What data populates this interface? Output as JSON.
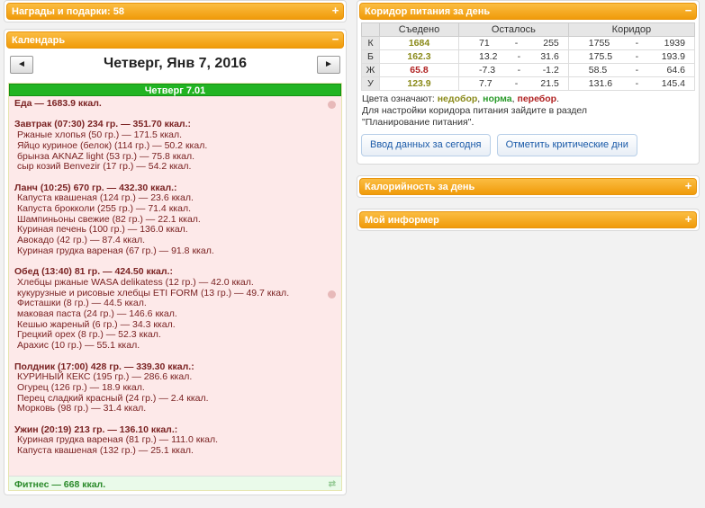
{
  "awards": {
    "title": "Награды и подарки: 58",
    "toggle": "+"
  },
  "calendar": {
    "title": "Календарь",
    "toggle": "−",
    "prev_label": "◄",
    "next_label": "►",
    "date": "Четверг, Янв 7, 2016",
    "day_header": "Четверг 7.01",
    "food_total": "Еда — 1683.9 ккал.",
    "meals": [
      {
        "title": "Завтрак (07:30) 234 гр. — 351.70 ккал.:",
        "items": [
          "Ржаные хлопья (50 гр.) — 171.5 ккал.",
          "Яйцо куриное (белок) (114 гр.) — 50.2 ккал.",
          "брынза AKNAZ light (53 гр.) — 75.8 ккал.",
          "сыр козий Benvezir (17 гр.) — 54.2 ккал."
        ]
      },
      {
        "title": "Ланч (10:25) 670 гр. — 432.30 ккал.:",
        "items": [
          "Капуста квашеная (124 гр.) — 23.6 ккал.",
          "Капуста брокколи (255 гр.) — 71.4 ккал.",
          "Шампиньоны свежие (82 гр.) — 22.1 ккал.",
          "Куриная печень (100 гр.) — 136.0 ккал.",
          "Авокадо (42 гр.) — 87.4 ккал.",
          "Куриная грудка вареная (67 гр.) — 91.8 ккал."
        ]
      },
      {
        "title": "Обед (13:40) 81 гр. — 424.50 ккал.:",
        "items": [
          "Хлебцы ржаные WASA delikatess (12 гр.) — 42.0 ккал.",
          "кукурузные и рисовые хлебцы ETI FORM (13 гр.) — 49.7 ккал.",
          "Фисташки (8 гр.) — 44.5 ккал.",
          "маковая паста (24 гр.) — 146.6 ккал.",
          "Кешью жареный (6 гр.) — 34.3 ккал.",
          "Грецкий орех (8 гр.) — 52.3 ккал.",
          "Арахис (10 гр.) — 55.1 ккал."
        ]
      },
      {
        "title": "Полдник (17:00) 428 гр. — 339.30 ккал.:",
        "items": [
          "КУРИНЫЙ КЕКС (195 гр.) — 286.6 ккал.",
          "Огурец (126 гр.) — 18.9 ккал.",
          "Перец сладкий красный (24 гр.) — 2.4 ккал.",
          "Морковь (98 гр.) — 31.4 ккал."
        ]
      },
      {
        "title": "Ужин (20:19) 213 гр. — 136.10 ккал.:",
        "items": [
          "Куриная грудка вареная (81 гр.) — 111.0 ккал.",
          "Капуста квашеная (132 гр.) — 25.1 ккал."
        ]
      }
    ],
    "fitness": "Фитнес — 668 ккал."
  },
  "corridor": {
    "title": "Коридор питания за день",
    "toggle": "−",
    "headers": [
      "",
      "Съедено",
      "Осталось",
      "Коридор"
    ],
    "rows": [
      {
        "label": "К",
        "eaten": "1684",
        "color": "#8a8a1a",
        "rem_a": "71",
        "rem_b": "255",
        "cor_a": "1755",
        "cor_b": "1939"
      },
      {
        "label": "Б",
        "eaten": "162.3",
        "color": "#8a8a1a",
        "rem_a": "13.2",
        "rem_b": "31.6",
        "cor_a": "175.5",
        "cor_b": "193.9"
      },
      {
        "label": "Ж",
        "eaten": "65.8",
        "color": "#b02222",
        "rem_a": "-7.3",
        "rem_b": "-1.2",
        "cor_a": "58.5",
        "cor_b": "64.6"
      },
      {
        "label": "У",
        "eaten": "123.9",
        "color": "#8a8a1a",
        "rem_a": "7.7",
        "rem_b": "21.5",
        "cor_a": "131.6",
        "cor_b": "145.4"
      }
    ],
    "dash": "-",
    "legend_prefix": "Цвета означают:",
    "legend_under": "недобор",
    "legend_norm": "норма",
    "legend_over": "перебор",
    "legend_sep": ",",
    "legend_end": ".",
    "note_line1": "Для настройки коридора питания зайдите в раздел",
    "note_line2": "\"Планирование питания\".",
    "button_enter": "Ввод данных за сегодня",
    "button_critical": "Отметить критические дни"
  },
  "calories": {
    "title": "Калорийность за день",
    "toggle": "+"
  },
  "informer": {
    "title": "Мой информер",
    "toggle": "+"
  },
  "colors": {
    "accent": "#f6a81a",
    "day_green": "#22b422",
    "food_text": "#7a2222",
    "link_blue": "#1a5aa8"
  }
}
